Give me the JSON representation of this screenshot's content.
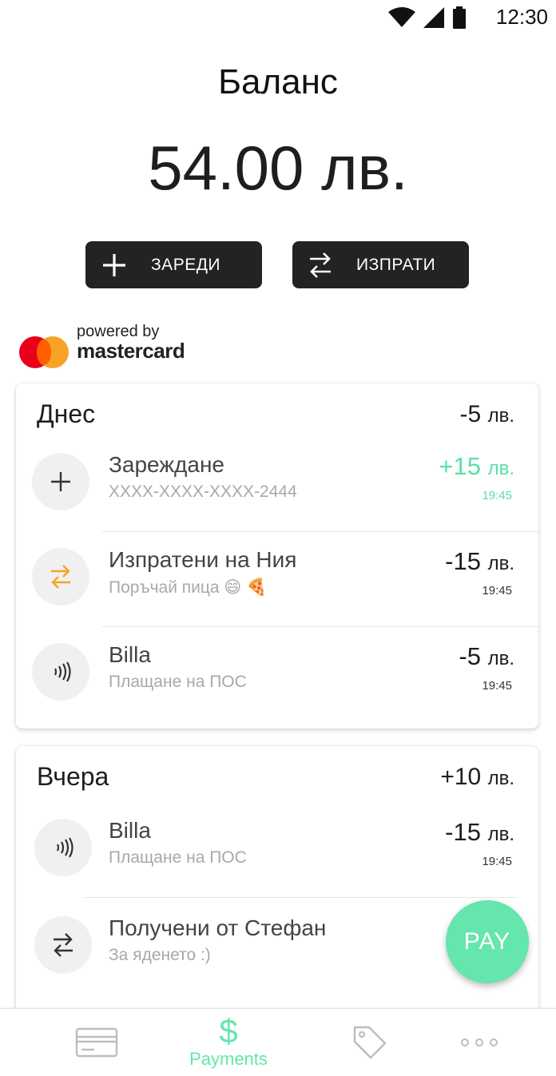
{
  "status_bar": {
    "time": "12:30"
  },
  "balance": {
    "label": "Баланс",
    "amount": "54.00 лв."
  },
  "actions": {
    "topup_label": "ЗАРЕДИ",
    "send_label": "ИЗПРАТИ"
  },
  "partner": {
    "powered_by": "powered by",
    "brand": "mastercard",
    "colors": {
      "red": "#eb001b",
      "orange": "#f79e1b"
    }
  },
  "groups": [
    {
      "day": "Днес",
      "total": "-5",
      "currency": "лв.",
      "transactions": [
        {
          "icon": "plus-icon",
          "title": "Зареждане",
          "subtitle": "XXXX-XXXX-XXXX-2444",
          "amount": "+15",
          "currency": "лв.",
          "time": "19:45"
        },
        {
          "icon": "transfer-icon",
          "title": "Изпратени на Ния",
          "subtitle": "Поръчай пица 😄 🍕",
          "amount": "-15",
          "currency": "лв.",
          "time": "19:45"
        },
        {
          "icon": "contactless-icon",
          "title": "Billa",
          "subtitle": "Плащане на ПОС",
          "amount": "-5",
          "currency": "лв.",
          "time": "19:45"
        }
      ]
    },
    {
      "day": "Вчера",
      "total": "+10",
      "currency": "лв.",
      "transactions": [
        {
          "icon": "contactless-icon",
          "title": "Billa",
          "subtitle": "Плащане на ПОС",
          "amount": "-15",
          "currency": "лв.",
          "time": "19:45"
        },
        {
          "icon": "transfer-icon",
          "title": "Получени от Стефан",
          "subtitle": "За яденето :)"
        }
      ]
    }
  ],
  "fab": {
    "label": "PAY"
  },
  "bottom_nav": {
    "payments_label": "Payments",
    "payments_symbol": "$"
  },
  "colors": {
    "accent": "#64e6ac",
    "income": "#5be0a5",
    "button_dark": "#232323",
    "transfer_orange": "#f5a623"
  }
}
